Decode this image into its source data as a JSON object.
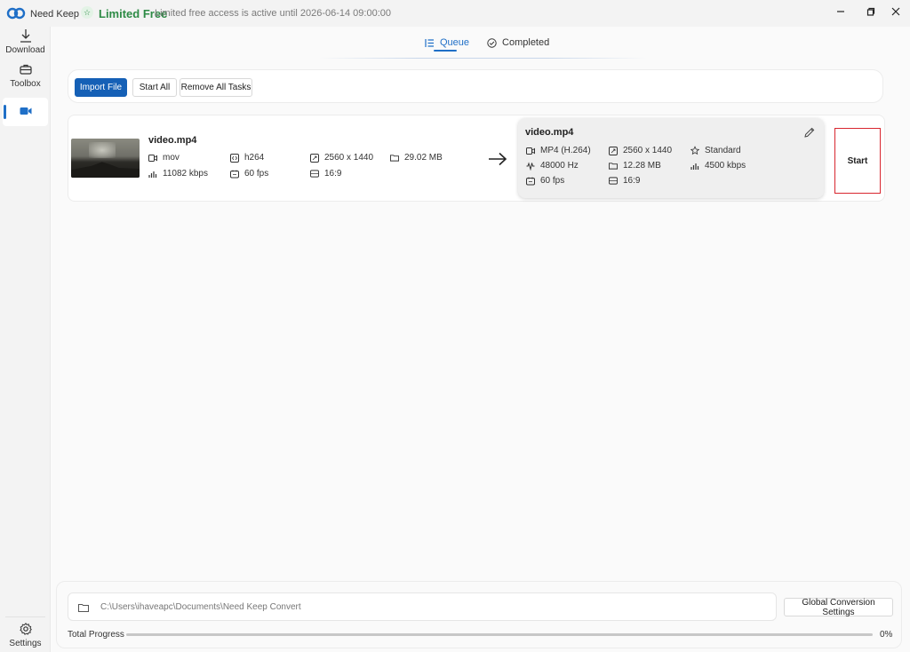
{
  "app": {
    "name": "Need Keep",
    "license_label": "Limited Free",
    "license_text": "Limited free access is active until 2026-06-14 09:00:00",
    "brand_color": "#1f6fc7"
  },
  "window_controls": {
    "minimize": "–",
    "maximize": "❐",
    "close": "✕"
  },
  "sidebar": {
    "items": [
      {
        "label": "Download",
        "icon": "download-icon"
      },
      {
        "label": "Toolbox",
        "icon": "toolbox-icon"
      },
      {
        "label": "",
        "icon": "video-camera-icon",
        "active": true
      }
    ],
    "settings_label": "Settings"
  },
  "tabs": [
    {
      "label": "Queue",
      "icon": "list-icon",
      "active": true
    },
    {
      "label": "Completed",
      "icon": "check-circle-icon"
    }
  ],
  "toolbar": {
    "import_label": "Import File",
    "start_all_label": "Start All",
    "remove_all_label": "Remove All Tasks"
  },
  "task": {
    "source": {
      "name": "video.mp4",
      "container": "mov",
      "codec": "h264",
      "resolution": "2560 x 1440",
      "size": "29.02 MB",
      "bitrate": "11082 kbps",
      "fps": "60 fps",
      "aspect": "16:9"
    },
    "output": {
      "name": "video.mp4",
      "format": "MP4 (H.264)",
      "resolution": "2560 x 1440",
      "quality": "Standard",
      "audio": "48000 Hz",
      "size": "12.28 MB",
      "bitrate": "4500 kbps",
      "fps": "60 fps",
      "aspect": "16:9"
    },
    "start_label": "Start"
  },
  "bottom": {
    "output_path": "C:\\Users\\ihaveapc\\Documents\\Need Keep Convert",
    "global_settings_label": "Global Conversion Settings",
    "progress_label": "Total Progress",
    "progress_value": 0,
    "progress_text": "0%"
  }
}
